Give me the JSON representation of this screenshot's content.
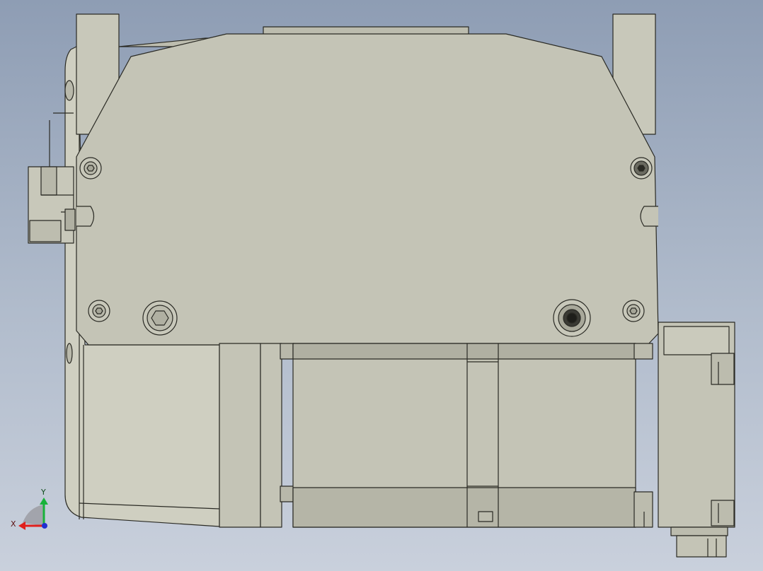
{
  "viewport": {
    "background_top": "#8e9db4",
    "background_bottom": "#c9d0dc"
  },
  "model": {
    "part_fill": "#c4c4b6",
    "part_fill_light": "#d0d0c2",
    "edge_color": "#2a2a24"
  },
  "triad": {
    "x_label": "X",
    "y_label": "Y",
    "x_color": "#e0201c",
    "y_color": "#18b23a",
    "z_color": "#2030d0"
  }
}
